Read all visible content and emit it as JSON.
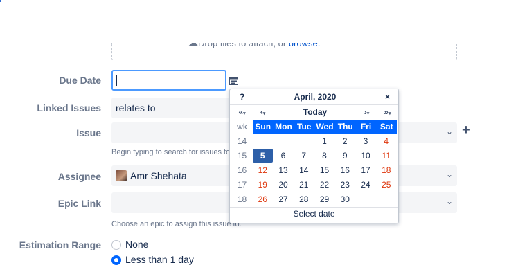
{
  "attachments": {
    "drop_text": "Drop files to attach, or ",
    "browse_link": "browse."
  },
  "due_date": {
    "label": "Due Date",
    "value": ""
  },
  "linked_issues": {
    "label": "Linked Issues",
    "value": "relates to"
  },
  "issue": {
    "label": "Issue",
    "value": "",
    "help": "Begin typing to search for issues to link"
  },
  "assignee": {
    "label": "Assignee",
    "value": "Amr Shehata"
  },
  "epic_link": {
    "label": "Epic Link",
    "value": "",
    "help": "Choose an epic to assign this issue to."
  },
  "estimation_range": {
    "label": "Estimation Range",
    "options": [
      "None",
      "Less than 1 day"
    ],
    "selected": "Less than 1 day"
  },
  "calendar": {
    "help_button": "?",
    "title": "April, 2020",
    "close_button": "×",
    "nav": {
      "prev_year": "«",
      "prev_month": "‹",
      "today": "Today",
      "next_month": "›",
      "next_year": "»"
    },
    "day_headers": [
      "wk",
      "Sun",
      "Mon",
      "Tue",
      "Wed",
      "Thu",
      "Fri",
      "Sat"
    ],
    "weeks": [
      [
        "14",
        "",
        "",
        "",
        "1",
        "2",
        "3",
        "4"
      ],
      [
        "15",
        "5",
        "6",
        "7",
        "8",
        "9",
        "10",
        "11"
      ],
      [
        "16",
        "12",
        "13",
        "14",
        "15",
        "16",
        "17",
        "18"
      ],
      [
        "17",
        "19",
        "20",
        "21",
        "22",
        "23",
        "24",
        "25"
      ],
      [
        "18",
        "26",
        "27",
        "28",
        "29",
        "30",
        "",
        ""
      ]
    ],
    "selected_day": "5",
    "footer": "Select date",
    "colors": {
      "header_bg": "#0065ff",
      "weekend": "#de350b",
      "today_bg": "#2d5fa8"
    }
  },
  "icons": {
    "calendar": "calendar-icon",
    "add": "plus-icon",
    "dropdown": "chevron-down-icon",
    "attach": "cloud-upload-icon"
  }
}
